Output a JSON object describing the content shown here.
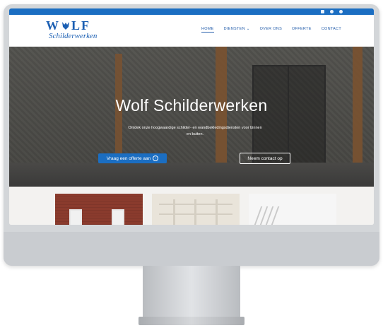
{
  "logo": {
    "line1": "W",
    "line1b": "LF",
    "line2": "Schilderwerken"
  },
  "nav": [
    {
      "label": "HOME",
      "active": true
    },
    {
      "label": "DIENSTEN ⌄",
      "active": false
    },
    {
      "label": "OVER ONS",
      "active": false
    },
    {
      "label": "OFFERTE",
      "active": false
    },
    {
      "label": "CONTACT",
      "active": false
    }
  ],
  "social": [
    "instagram-icon",
    "facebook-icon",
    "whatsapp-icon"
  ],
  "hero": {
    "title": "Wolf Schilderwerken",
    "subtitle": "Ontdek onze hoogwaardige schilder- en wandbekledingsdiensten voor binnen en buiten.",
    "primary_button": "Vraag een offerte aan",
    "secondary_button": "Neem contact op"
  },
  "colors": {
    "brand": "#1b6ec2",
    "nav_text": "#2a62ad"
  }
}
